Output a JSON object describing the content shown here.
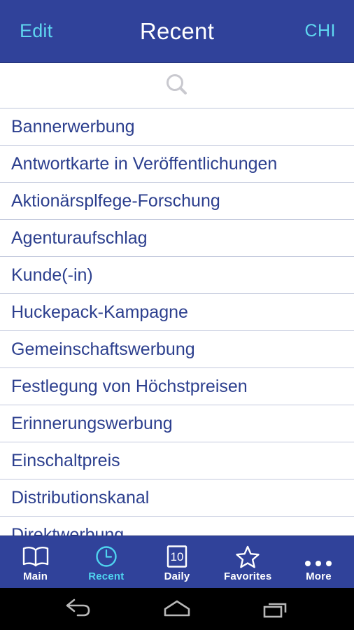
{
  "header": {
    "edit_label": "Edit",
    "title": "Recent",
    "language_label": "CHI",
    "background_color": "#30429a",
    "accent_color": "#5fd7f0"
  },
  "search": {
    "icon": "search-icon",
    "value": "",
    "placeholder": ""
  },
  "list": {
    "items": [
      {
        "label": "Bannerwerbung"
      },
      {
        "label": "Antwortkarte in Veröffentlichungen"
      },
      {
        "label": "Aktionärsplfege-Forschung"
      },
      {
        "label": "Agenturaufschlag"
      },
      {
        "label": "Kunde(-in)"
      },
      {
        "label": "Huckepack-Kampagne"
      },
      {
        "label": "Gemeinschaftswerbung"
      },
      {
        "label": "Festlegung von Höchstpreisen"
      },
      {
        "label": "Erinnerungswerbung"
      },
      {
        "label": "Einschaltpreis"
      },
      {
        "label": "Distributionskanal"
      },
      {
        "label": "Direktwerbung"
      }
    ],
    "text_color": "#2c3f8e",
    "separator_color": "#c3c9dd"
  },
  "tabbar": {
    "active_color": "#4fd4ef",
    "inactive_color": "#ffffff",
    "tabs": [
      {
        "label": "Main",
        "icon": "book-icon",
        "active": false
      },
      {
        "label": "Recent",
        "icon": "clock-icon",
        "active": true
      },
      {
        "label": "Daily",
        "icon": "calendar-icon",
        "badge": "10",
        "active": false
      },
      {
        "label": "Favorites",
        "icon": "star-icon",
        "active": false
      },
      {
        "label": "More",
        "icon": "ellipsis-icon",
        "active": false
      }
    ]
  },
  "navbar": {
    "buttons": [
      {
        "name": "back-icon"
      },
      {
        "name": "home-icon"
      },
      {
        "name": "recent-apps-icon"
      }
    ]
  }
}
